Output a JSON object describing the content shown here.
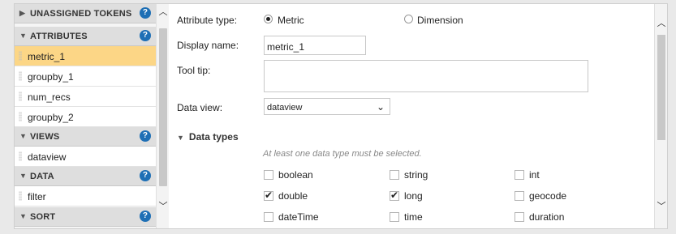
{
  "sidebar": {
    "sections": [
      {
        "label": "UNASSIGNED TOKENS",
        "help": "?"
      },
      {
        "label": "ATTRIBUTES",
        "help": "?"
      },
      {
        "label": "VIEWS",
        "help": "?"
      },
      {
        "label": "DATA",
        "help": "?"
      },
      {
        "label": "SORT",
        "help": "?"
      }
    ],
    "attributes": [
      "metric_1",
      "groupby_1",
      "num_recs",
      "groupby_2"
    ],
    "views": [
      "dataview"
    ],
    "data": [
      "filter"
    ]
  },
  "form": {
    "attribute_type_label": "Attribute type:",
    "metric_label": "Metric",
    "dimension_label": "Dimension",
    "selected_type": "Metric",
    "display_name_label": "Display name:",
    "display_name_value": "metric_1",
    "tooltip_label": "Tool tip:",
    "tooltip_value": "",
    "data_view_label": "Data view:",
    "data_view_value": "dataview",
    "data_types_label": "Data types",
    "hint": "At least one data type must be selected.",
    "types": [
      {
        "label": "boolean",
        "checked": false
      },
      {
        "label": "string",
        "checked": false
      },
      {
        "label": "int",
        "checked": false
      },
      {
        "label": "double",
        "checked": true
      },
      {
        "label": "long",
        "checked": true
      },
      {
        "label": "geocode",
        "checked": false
      },
      {
        "label": "dateTime",
        "checked": false
      },
      {
        "label": "time",
        "checked": false
      },
      {
        "label": "duration",
        "checked": false
      }
    ]
  },
  "icons": {
    "expand": "triangle-right-icon",
    "collapse": "triangle-down-icon",
    "help": "question-circle-icon",
    "scroll_up": "chevron-up-icon",
    "scroll_down": "chevron-down-icon",
    "dropdown": "chevron-down-icon"
  },
  "colors": {
    "selected_item": "#fcd686",
    "help_icon": "#1e6fb5",
    "section_header": "#dedede"
  }
}
